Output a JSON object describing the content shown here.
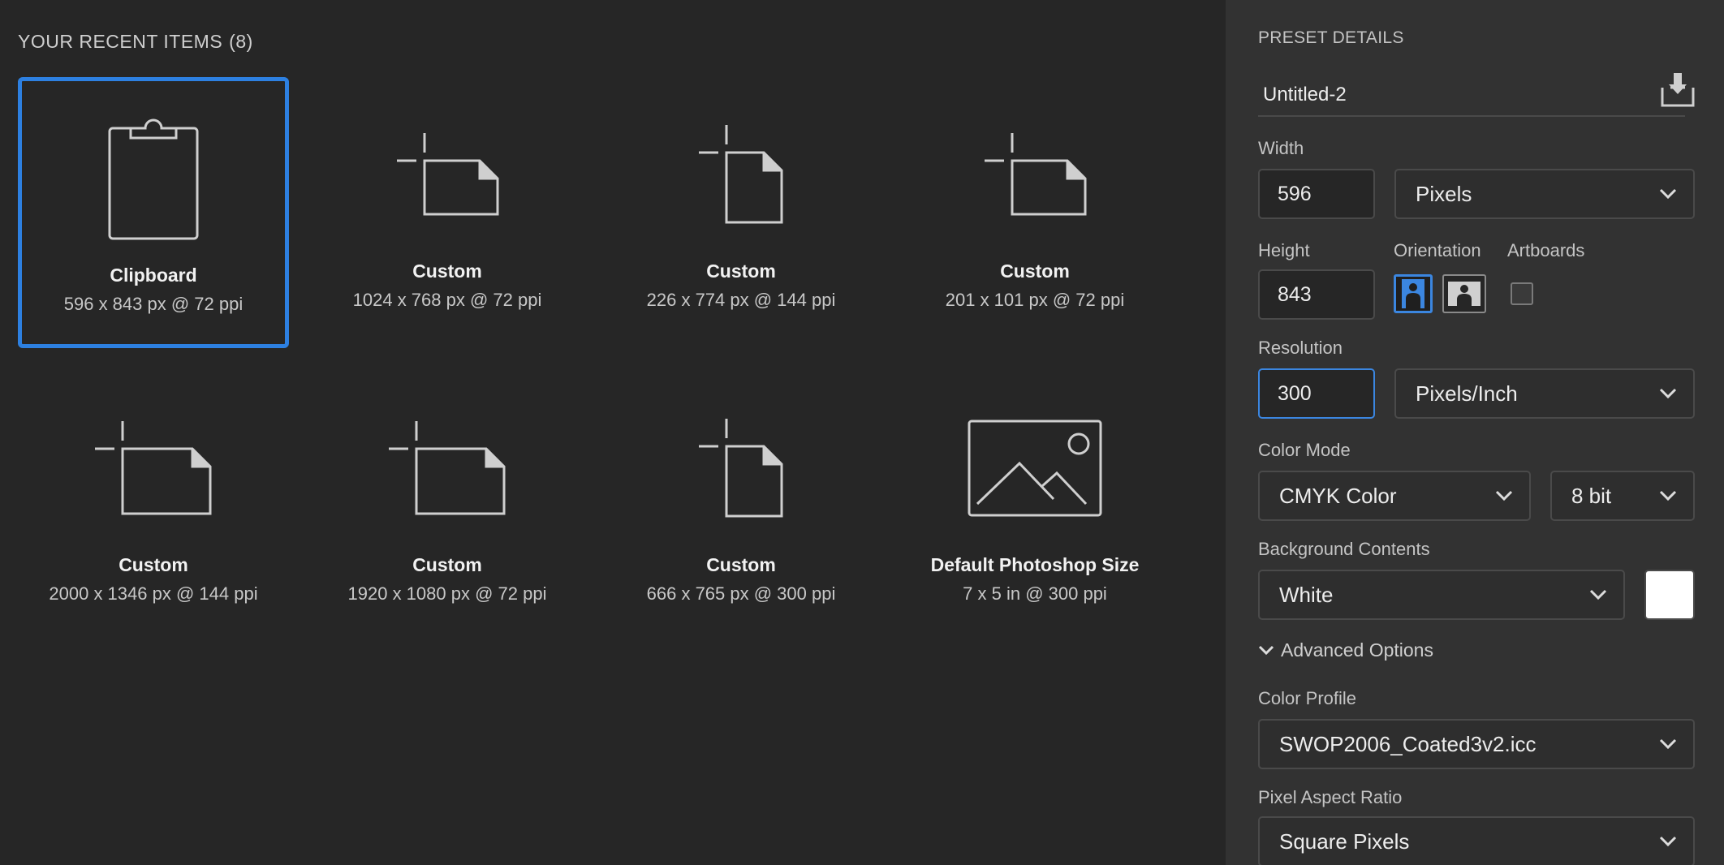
{
  "recent": {
    "title": "YOUR RECENT ITEMS",
    "count": "(8)",
    "items": [
      {
        "name": "Clipboard",
        "meta": "596 x 843 px @ 72 ppi",
        "icon": "clipboard-icon"
      },
      {
        "name": "Custom",
        "meta": "1024 x 768 px @ 72 ppi",
        "icon": "landscape-doc-icon"
      },
      {
        "name": "Custom",
        "meta": "226 x 774 px @ 144 ppi",
        "icon": "portrait-doc-icon"
      },
      {
        "name": "Custom",
        "meta": "201 x 101 px @ 72 ppi",
        "icon": "landscape-doc-icon"
      },
      {
        "name": "Custom",
        "meta": "2000 x 1346 px @ 144 ppi",
        "icon": "landscape-doc-icon"
      },
      {
        "name": "Custom",
        "meta": "1920 x 1080 px @ 72 ppi",
        "icon": "landscape-doc-icon"
      },
      {
        "name": "Custom",
        "meta": "666 x 765 px @ 300 ppi",
        "icon": "portrait-doc-icon"
      },
      {
        "name": "Default Photoshop Size",
        "meta": "7 x 5 in @ 300 ppi",
        "icon": "image-icon"
      }
    ]
  },
  "preset": {
    "section_title": "PRESET DETAILS",
    "doc_name": "Untitled-2",
    "width_label": "Width",
    "width_value": "596",
    "width_unit": "Pixels",
    "height_label": "Height",
    "height_value": "843",
    "orientation_label": "Orientation",
    "artboards_label": "Artboards",
    "resolution_label": "Resolution",
    "resolution_value": "300",
    "resolution_unit": "Pixels/Inch",
    "color_mode_label": "Color Mode",
    "color_mode": "CMYK Color",
    "bit_depth": "8 bit",
    "background_label": "Background Contents",
    "background": "White",
    "advanced_label": "Advanced Options",
    "color_profile_label": "Color Profile",
    "color_profile": "SWOP2006_Coated3v2.icc",
    "pixel_aspect_label": "Pixel Aspect Ratio",
    "pixel_aspect": "Square Pixels"
  },
  "colors": {
    "accent": "#2d80e1",
    "background": "#262626",
    "panel": "#323232",
    "swatch": "#ffffff"
  }
}
